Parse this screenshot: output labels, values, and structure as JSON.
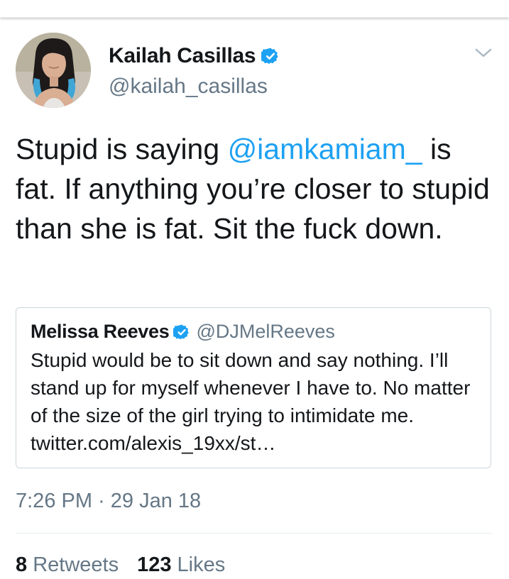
{
  "author": {
    "display_name": "Kailah Casillas",
    "handle": "@kailah_casillas",
    "verified": true,
    "avatar_icon": "profile-photo"
  },
  "tweet": {
    "text_before_mention": "Stupid is saying ",
    "mention": "@iamkamiam_",
    "text_after_mention": " is fat. If anything you’re closer to stupid than she is fat. Sit the fuck down."
  },
  "quoted_tweet": {
    "display_name": "Melissa Reeves",
    "handle": "@DJMelReeves",
    "verified": true,
    "text": "Stupid would be to sit down and say nothing. I’ll stand up for myself whenever I have to. No matter of the size of the girl trying to intimidate me. twitter.com/alexis_19xx/st…"
  },
  "timestamp": "7:26 PM · 29 Jan 18",
  "stats": {
    "retweets_count": "8",
    "retweets_label": "Retweets",
    "likes_count": "123",
    "likes_label": "Likes"
  },
  "colors": {
    "accent": "#1da1f2",
    "text_primary": "#14171a",
    "text_secondary": "#657786",
    "border": "#ccd6dd"
  },
  "icons": {
    "verified": "verified-badge-icon",
    "more": "chevron-down-icon"
  }
}
